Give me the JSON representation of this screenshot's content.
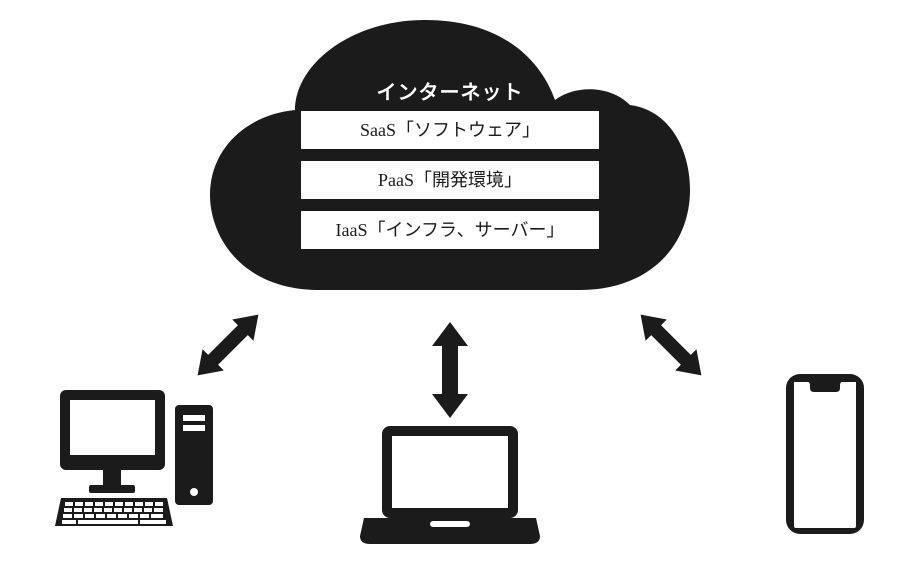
{
  "cloud": {
    "title": "インターネット",
    "layers": [
      {
        "label": "SaaS「ソフトウェア」"
      },
      {
        "label": "PaaS「開発環境」"
      },
      {
        "label": "IaaS「インフラ、サーバー」"
      }
    ]
  },
  "devices": {
    "pc": "デスクトップPC",
    "laptop": "ノートPC",
    "phone": "スマートフォン"
  },
  "colors": {
    "cloud": "#1b1b1b",
    "bg": "#ffffff"
  }
}
